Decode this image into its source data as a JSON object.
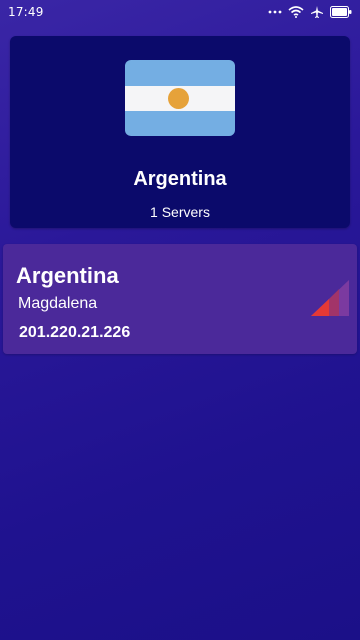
{
  "status_bar": {
    "time": "17:49",
    "icons": [
      "dots-icon",
      "wifi-icon",
      "airplane-icon",
      "battery-icon"
    ]
  },
  "country_card": {
    "flag": "argentina-flag",
    "title": "Argentina",
    "server_count": "1 Servers"
  },
  "servers": [
    {
      "country": "Argentina",
      "city": "Magdalena",
      "ip": "201.220.21.226",
      "signal_icon": "signal-strength-icon",
      "signal_level": "low"
    }
  ],
  "colors": {
    "background": "#2a1899",
    "card": "#0b0a6b",
    "server_row": "#4b299a",
    "signal_active": "#e53935",
    "signal_inactive": "#7b3aa0"
  }
}
